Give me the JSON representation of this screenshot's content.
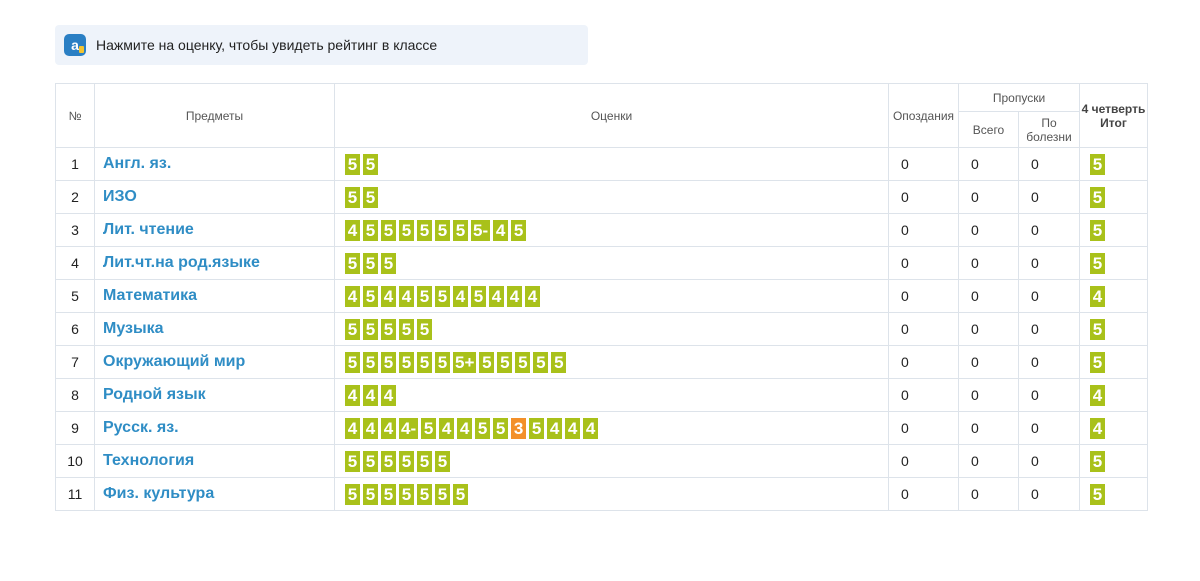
{
  "hint": {
    "logo_icon": "app-logo-icon",
    "text": "Нажмите на оценку, чтобы увидеть рейтинг в классе"
  },
  "table": {
    "headers": {
      "num": "№",
      "subjects": "Предметы",
      "grades": "Оценки",
      "late": "Опоздания",
      "absences": "Пропуски",
      "absences_total": "Всего",
      "absences_sick": "По болезни",
      "quarter": "4 четверть",
      "quarter_final": "Итог"
    },
    "rows": [
      {
        "num": "1",
        "subject": "Англ. яз.",
        "grades": [
          "5",
          "5"
        ],
        "late": "0",
        "total": "0",
        "sick": "0",
        "final": "5"
      },
      {
        "num": "2",
        "subject": "ИЗО",
        "grades": [
          "5",
          "5"
        ],
        "late": "0",
        "total": "0",
        "sick": "0",
        "final": "5"
      },
      {
        "num": "3",
        "subject": "Лит. чтение",
        "grades": [
          "4",
          "5",
          "5",
          "5",
          "5",
          "5",
          "5",
          "5-",
          "4",
          "5"
        ],
        "late": "0",
        "total": "0",
        "sick": "0",
        "final": "5"
      },
      {
        "num": "4",
        "subject": "Лит.чт.на род.языке",
        "grades": [
          "5",
          "5",
          "5"
        ],
        "late": "0",
        "total": "0",
        "sick": "0",
        "final": "5"
      },
      {
        "num": "5",
        "subject": "Математика",
        "grades": [
          "4",
          "5",
          "4",
          "4",
          "5",
          "5",
          "4",
          "5",
          "4",
          "4",
          "4"
        ],
        "late": "0",
        "total": "0",
        "sick": "0",
        "final": "4"
      },
      {
        "num": "6",
        "subject": "Музыка",
        "grades": [
          "5",
          "5",
          "5",
          "5",
          "5"
        ],
        "late": "0",
        "total": "0",
        "sick": "0",
        "final": "5"
      },
      {
        "num": "7",
        "subject": "Окружающий мир",
        "grades": [
          "5",
          "5",
          "5",
          "5",
          "5",
          "5",
          "5+",
          "5",
          "5",
          "5",
          "5",
          "5"
        ],
        "late": "0",
        "total": "0",
        "sick": "0",
        "final": "5"
      },
      {
        "num": "8",
        "subject": "Родной язык",
        "grades": [
          "4",
          "4",
          "4"
        ],
        "late": "0",
        "total": "0",
        "sick": "0",
        "final": "4"
      },
      {
        "num": "9",
        "subject": "Русск. яз.",
        "grades": [
          "4",
          "4",
          "4",
          "4-",
          "5",
          "4",
          "4",
          "5",
          "5",
          "3",
          "5",
          "4",
          "4",
          "4"
        ],
        "late": "0",
        "total": "0",
        "sick": "0",
        "final": "4"
      },
      {
        "num": "10",
        "subject": "Технология",
        "grades": [
          "5",
          "5",
          "5",
          "5",
          "5",
          "5"
        ],
        "late": "0",
        "total": "0",
        "sick": "0",
        "final": "5"
      },
      {
        "num": "11",
        "subject": "Физ. культура",
        "grades": [
          "5",
          "5",
          "5",
          "5",
          "5",
          "5",
          "5"
        ],
        "late": "0",
        "total": "0",
        "sick": "0",
        "final": "5"
      }
    ]
  },
  "colors": {
    "good_mark": "#a9c11a",
    "bad_mark": "#f3902a",
    "subject_link": "#2f8dc5"
  }
}
